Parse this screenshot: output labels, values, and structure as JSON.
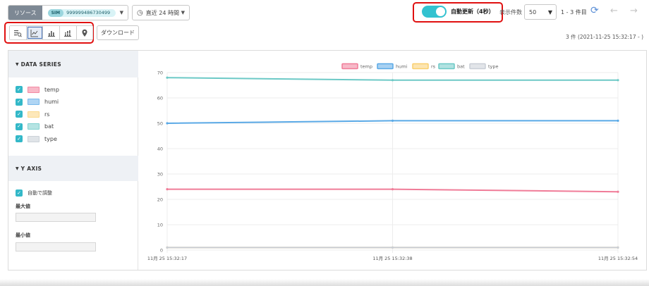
{
  "header": {
    "resource_label": "リソース",
    "sim_badge": "SIM",
    "sim_id": "999999486730499",
    "period_label": "直近 24 時間",
    "auto_refresh_label": "自動更新（4秒）",
    "auto_refresh_on": true,
    "page_size_label": "表示件数",
    "page_size_value": "50",
    "page_range": "1 - 3 件目"
  },
  "toolbar": {
    "download_label": "ダウンロード",
    "result_info": "3 件 (2021-11-25 15:32:17 - )",
    "icons": [
      "table-view-icon",
      "line-chart-icon",
      "bar-chart-icon",
      "stacked-bar-icon",
      "map-pin-icon"
    ],
    "active_view": "line-chart-icon"
  },
  "sidebar": {
    "data_series_title": "DATA SERIES",
    "series": [
      {
        "name": "temp",
        "color": "#f38aa3",
        "checked": true
      },
      {
        "name": "humi",
        "color": "#7ab9ec",
        "checked": true
      },
      {
        "name": "rs",
        "color": "#fbd98c",
        "checked": true
      },
      {
        "name": "bat",
        "color": "#83d2d0",
        "checked": true
      },
      {
        "name": "type",
        "color": "#ccd2d8",
        "checked": true
      }
    ],
    "y_axis_title": "Y AXIS",
    "auto_adjust_label": "自動で調整",
    "max_label": "最大値",
    "min_label": "最小値",
    "max_value": "",
    "min_value": ""
  },
  "chart_data": {
    "type": "line",
    "x": [
      "11月 25 15:32:17",
      "11月 25 15:32:38",
      "11月 25 15:32:54"
    ],
    "ylim": [
      0,
      70
    ],
    "yticks": [
      0,
      10,
      20,
      30,
      40,
      50,
      60,
      70
    ],
    "grid": true,
    "legend": "top",
    "series": [
      {
        "name": "temp",
        "color": "#f07c98",
        "values": [
          24,
          24,
          23
        ]
      },
      {
        "name": "humi",
        "color": "#5aa9e6",
        "values": [
          50,
          51,
          51
        ]
      },
      {
        "name": "rs",
        "color": "#f9cf6e",
        "values": [
          1,
          1,
          1
        ]
      },
      {
        "name": "bat",
        "color": "#6cc9c6",
        "values": [
          68,
          67,
          67
        ]
      },
      {
        "name": "type",
        "color": "#c9ced6",
        "values": [
          1,
          1,
          1
        ]
      }
    ]
  }
}
